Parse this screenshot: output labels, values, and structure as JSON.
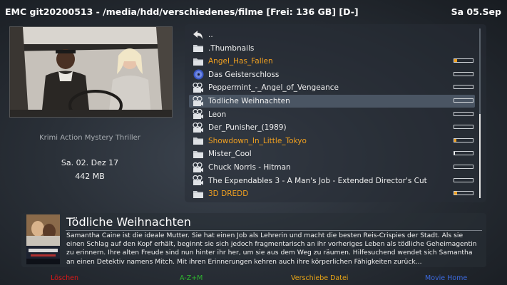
{
  "header": {
    "title": "EMC git20200513 - /media/hdd/verschiedenes/filme [Frei: 136 GB] [D-]",
    "clock": "Sa 05.Sep"
  },
  "details": {
    "genres": "Krimi Action Mystery Thriller",
    "date": "Sa. 02. Dez 17",
    "size": "442 MB"
  },
  "list": [
    {
      "label": "..",
      "icon": "back-arrow-icon",
      "color": "white",
      "progress": null
    },
    {
      "label": ".Thumbnails",
      "icon": "folder-icon",
      "color": "white",
      "progress": null
    },
    {
      "label": "Angel_Has_Fallen",
      "icon": "folder-icon",
      "color": "orange",
      "progress": 0.15
    },
    {
      "label": "Das Geisterschloss",
      "icon": "dvd-icon",
      "color": "white",
      "progress": 0
    },
    {
      "label": "Peppermint_-_Angel_of_Vengeance",
      "icon": "film-camera-icon",
      "color": "white",
      "progress": 0
    },
    {
      "label": "Tödliche Weihnachten",
      "icon": "film-camera-icon",
      "color": "white",
      "progress": 0,
      "selected": true
    },
    {
      "label": "Leon",
      "icon": "film-camera-icon",
      "color": "white",
      "progress": 0
    },
    {
      "label": "Der_Punisher_(1989)",
      "icon": "film-camera-icon",
      "color": "white",
      "progress": 0
    },
    {
      "label": "Showdown_In_Little_Tokyo",
      "icon": "folder-icon",
      "color": "orange",
      "progress": 0.1
    },
    {
      "label": "Mister_Cool",
      "icon": "folder-icon",
      "color": "white",
      "progress": 0.05
    },
    {
      "label": "Chuck Norris - Hitman",
      "icon": "film-camera-icon",
      "color": "white",
      "progress": 0
    },
    {
      "label": "The Expendables 3 - A Man's Job - Extended Director's Cut",
      "icon": "film-camera-icon",
      "color": "white",
      "progress": 0
    },
    {
      "label": "3D DREDD",
      "icon": "folder-icon",
      "color": "orange",
      "progress": 0.15
    }
  ],
  "info": {
    "title": "Tödliche Weihnachten",
    "description": "Samantha Caine ist die ideale Mutter. Sie hat einen Job als Lehrerin und macht die besten Reis-Crispies der Stadt. Als sie einen Schlag auf den Kopf erhält, beginnt sie sich jedoch fragmentarisch an ihr vorheriges Leben als tödliche Geheimagentin zu erinnern. Ihre alten Freude sind nun hinter ihr her, um sie aus dem Weg zu räumen. Hilfesuchend wendet sich Samantha an einen Detektiv namens Mitch. Mit ihren Erinnerungen kehren auch ihre körperlichen Fähigkeiten zurück..."
  },
  "footer": {
    "red": "Löschen",
    "green": "A-Z+M",
    "yellow": "Verschiebe Datei",
    "blue": "Movie Home"
  },
  "colors": {
    "orange": "#f0a020",
    "red": "#e01818",
    "green": "#2fb52f",
    "yellow": "#e8a516",
    "blue": "#3d6be0"
  }
}
